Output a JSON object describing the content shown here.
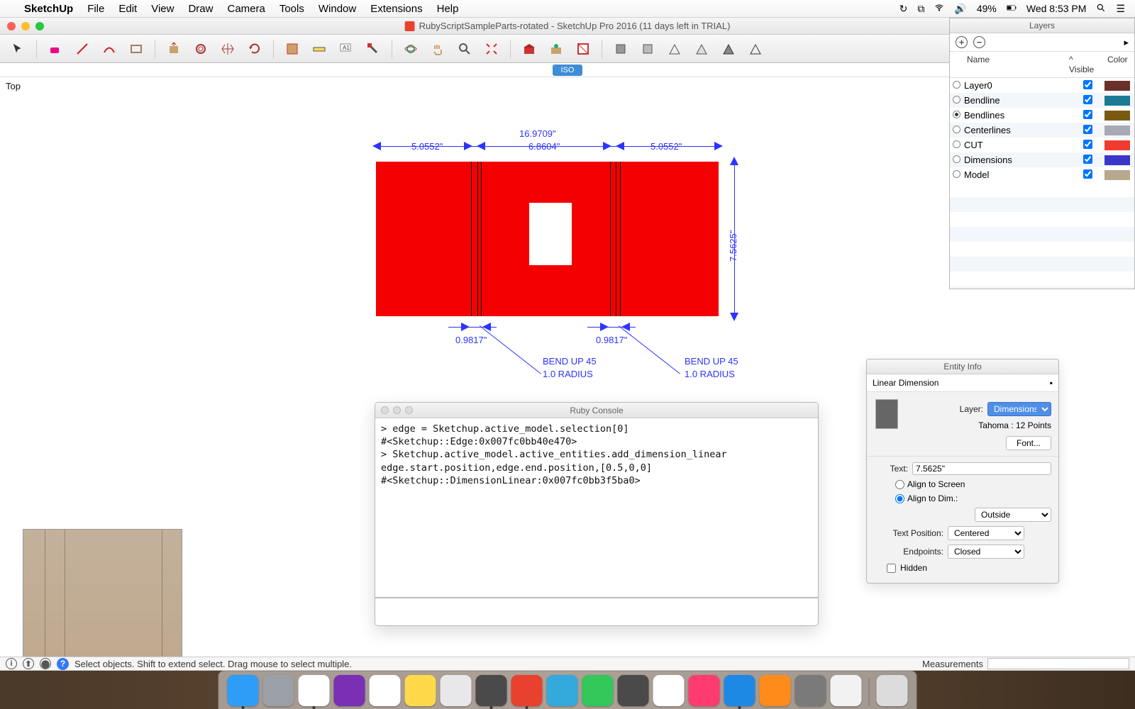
{
  "menubar": {
    "app": "SketchUp",
    "items": [
      "File",
      "Edit",
      "View",
      "Draw",
      "Camera",
      "Tools",
      "Window",
      "Extensions",
      "Help"
    ],
    "battery": "49%",
    "clock": "Wed 8:53 PM"
  },
  "window": {
    "title": "RubyScriptSampleParts-rotated - SketchUp Pro 2016 (11 days left in TRIAL)"
  },
  "tabs": {
    "active": "ISO"
  },
  "view": {
    "label": "Top",
    "dims": {
      "total_w": "16.9709\"",
      "left": "5.0552\"",
      "center": "6.8604\"",
      "right": "5.0552\"",
      "gap1": "0.9817\"",
      "gap2": "0.9817\"",
      "height": "7.5625\""
    },
    "notes": {
      "b1a": "BEND UP 45",
      "b1b": "1.0 RADIUS",
      "b2a": "BEND UP 45",
      "b2b": "1.0 RADIUS"
    }
  },
  "console": {
    "title": "Ruby Console",
    "text": "> edge = Sketchup.active_model.selection[0]\n#<Sketchup::Edge:0x007fc0bb40e470>\n> Sketchup.active_model.active_entities.add_dimension_linear edge.start.position,edge.end.position,[0.5,0,0]\n#<Sketchup::DimensionLinear:0x007fc0bb3f5ba0>"
  },
  "layers": {
    "title": "Layers",
    "cols": {
      "name": "Name",
      "visible": "Visible",
      "color": "Color"
    },
    "rows": [
      {
        "name": "Layer0",
        "visible": true,
        "color": "#6b2f2a",
        "active": false
      },
      {
        "name": "Bendline",
        "visible": true,
        "color": "#1d7a94",
        "active": false
      },
      {
        "name": "Bendlines",
        "visible": true,
        "color": "#7a5a12",
        "active": true
      },
      {
        "name": "Centerlines",
        "visible": true,
        "color": "#a9a9b5",
        "active": false
      },
      {
        "name": "CUT",
        "visible": true,
        "color": "#f13b30",
        "active": false
      },
      {
        "name": "Dimensions",
        "visible": true,
        "color": "#3b36c9",
        "active": false
      },
      {
        "name": "Model",
        "visible": true,
        "color": "#b8a88e",
        "active": false
      }
    ]
  },
  "entity": {
    "title": "Entity Info",
    "type": "Linear Dimension",
    "layer_label": "Layer:",
    "layer_value": "Dimensions",
    "font_desc": "Tahoma : 12 Points",
    "font_btn": "Font...",
    "text_label": "Text:",
    "text_value": "7.5625\"",
    "align_screen": "Align to Screen",
    "align_dim": "Align to Dim.:",
    "align_value": "Outside",
    "textpos_label": "Text Position:",
    "textpos_value": "Centered",
    "endpoints_label": "Endpoints:",
    "endpoints_value": "Closed",
    "hidden_label": "Hidden"
  },
  "status": {
    "hint": "Select objects. Shift to extend select. Drag mouse to select multiple.",
    "measurements_label": "Measurements"
  },
  "dock": [
    {
      "name": "finder",
      "bg": "#2e9df7",
      "running": true
    },
    {
      "name": "launchpad",
      "bg": "#9aa0a6",
      "running": false
    },
    {
      "name": "chrome",
      "bg": "#ffffff",
      "running": true
    },
    {
      "name": "protools",
      "bg": "#7a2fb5",
      "running": false
    },
    {
      "name": "calendar",
      "bg": "#ffffff",
      "running": false
    },
    {
      "name": "notes",
      "bg": "#ffd94a",
      "running": false
    },
    {
      "name": "xcode",
      "bg": "#e8e8ea",
      "running": false
    },
    {
      "name": "sublime",
      "bg": "#4a4a4a",
      "running": true
    },
    {
      "name": "sketchup",
      "bg": "#e8412f",
      "running": true
    },
    {
      "name": "messages",
      "bg": "#34aadc",
      "running": false
    },
    {
      "name": "facetime",
      "bg": "#34c759",
      "running": false
    },
    {
      "name": "photobooth",
      "bg": "#4a4a4a",
      "running": false
    },
    {
      "name": "photos",
      "bg": "#ffffff",
      "running": false
    },
    {
      "name": "itunes",
      "bg": "#ff3b72",
      "running": false
    },
    {
      "name": "appstore",
      "bg": "#1e88e5",
      "running": true
    },
    {
      "name": "vlc",
      "bg": "#ff8c1a",
      "running": false
    },
    {
      "name": "preferences",
      "bg": "#7a7a7a",
      "running": false
    },
    {
      "name": "evernote",
      "bg": "#f2f2f2",
      "running": false
    },
    {
      "name": "trash",
      "bg": "#dcdcdc",
      "running": false
    }
  ]
}
